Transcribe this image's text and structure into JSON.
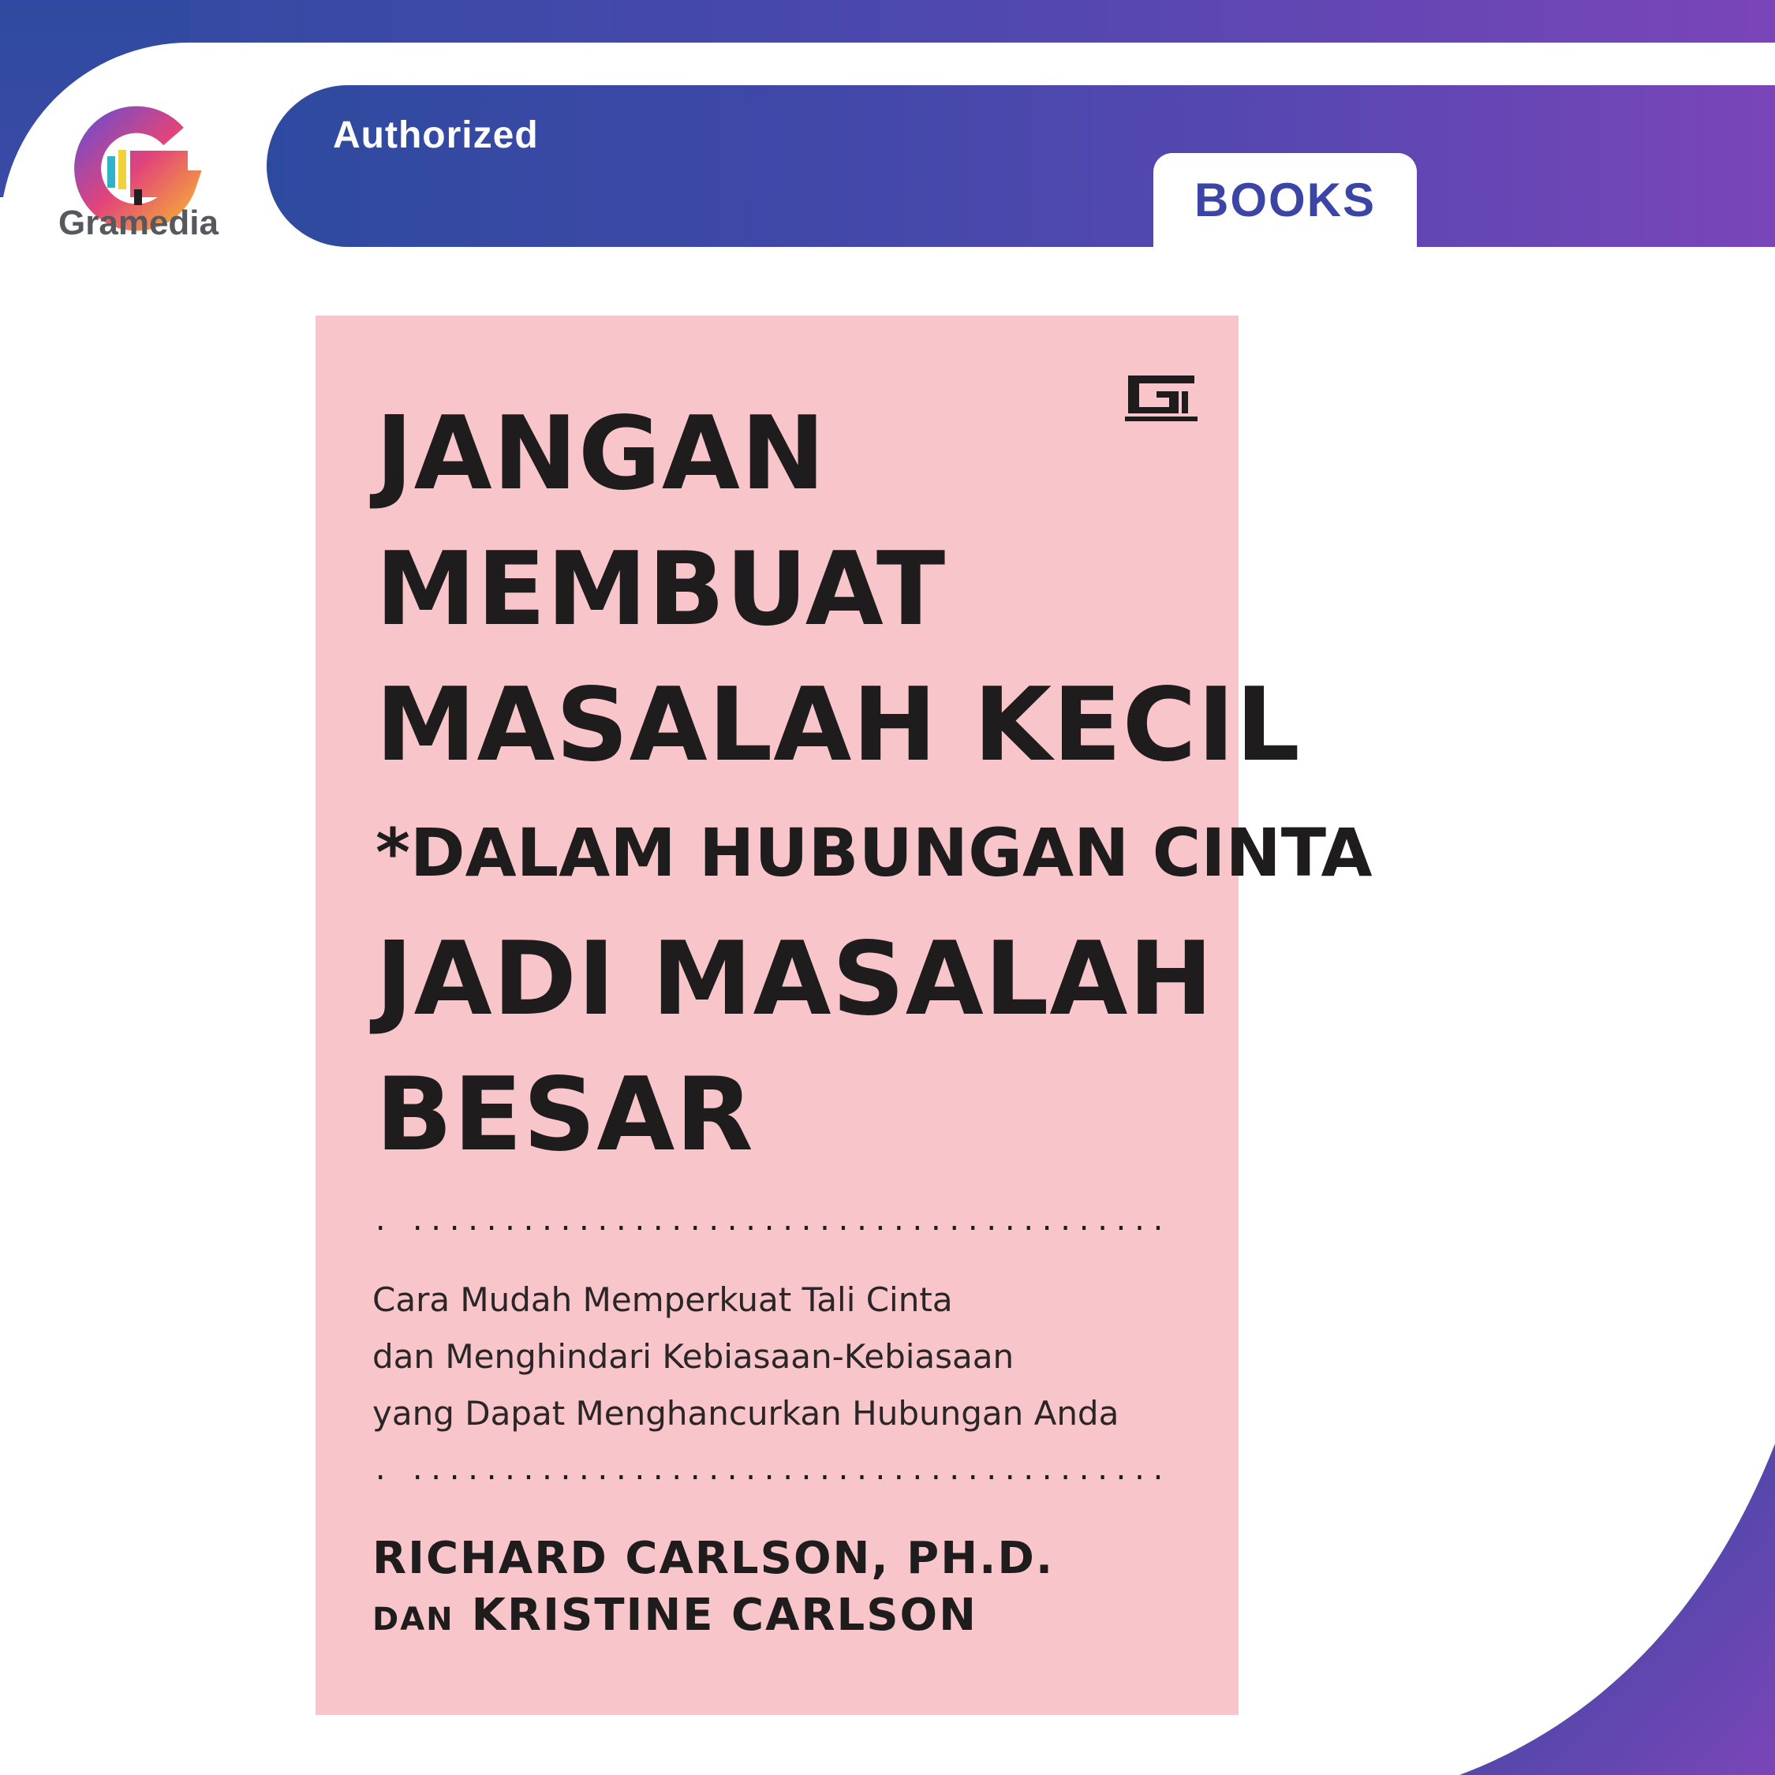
{
  "brand": {
    "name": "Gramedia",
    "badge": "Authorized",
    "category_tab": "BOOKS"
  },
  "book": {
    "title_lines": [
      "JANGAN",
      "MEMBUAT",
      "MASALAH KECIL"
    ],
    "subtitle_line": "*DALAM HUBUNGAN CINTA",
    "title_tail_lines": [
      "JADI MASALAH",
      "BESAR"
    ],
    "dots_top": ".  .................................................",
    "tagline_lines": [
      "Cara Mudah Memperkuat Tali Cinta",
      "dan Menghindari Kebiasaan-Kebiasaan",
      "yang Dapat Menghancurkan Hubungan Anda"
    ],
    "dots_bottom": ".  .................................................",
    "author_1": "RICHARD CARLSON, PH.D.",
    "author_conj": "DAN",
    "author_2": "KRISTINE CARLSON",
    "publisher_icon": "gramedia-publisher-icon",
    "cover_color": "#f8c6ca"
  },
  "colors": {
    "gradient_start": "#2e4a9f",
    "gradient_end": "#7a45b8",
    "tab_text": "#3a45a6"
  }
}
